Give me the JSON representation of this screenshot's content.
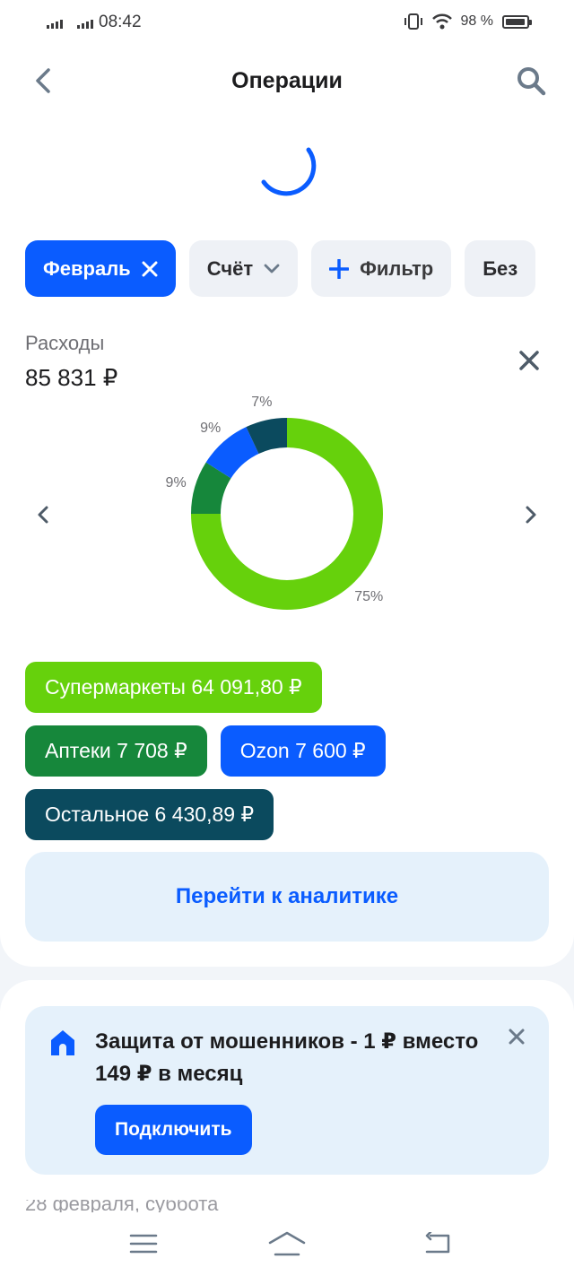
{
  "status_bar": {
    "time": "08:42",
    "battery": "98 %"
  },
  "header": {
    "title": "Операции"
  },
  "filters": [
    {
      "label": "Февраль",
      "active": true,
      "icon": "close-icon"
    },
    {
      "label": "Счёт",
      "active": false,
      "icon": "chevron-down-icon"
    },
    {
      "label": "Фильтр",
      "active": false,
      "icon": "plus-icon"
    },
    {
      "label": "Без",
      "active": false,
      "icon": ""
    }
  ],
  "expenses": {
    "label": "Расходы",
    "value": "85 831 ₽"
  },
  "chart_data": {
    "type": "pie",
    "title": "",
    "categories": [
      "Супермаркеты",
      "Аптеки",
      "Ozon",
      "Остальное"
    ],
    "values": [
      75,
      9,
      9,
      7
    ],
    "value_labels": [
      "75%",
      "9%",
      "9%",
      "7%"
    ],
    "colors": [
      "#66d10c",
      "#16873b",
      "#0a5cff",
      "#0b4a5e"
    ]
  },
  "legend": [
    {
      "label": "Супермаркеты 64 091,80 ₽",
      "color": "#66d10c"
    },
    {
      "label": "Аптеки 7 708 ₽",
      "color": "#16873b"
    },
    {
      "label": "Ozon 7 600 ₽",
      "color": "#0a5cff"
    },
    {
      "label": "Остальное 6 430,89 ₽",
      "color": "#0b4a5e"
    }
  ],
  "analytics_button": "Перейти к аналитике",
  "promo": {
    "title": "Защита от мошенников - 1 ₽ вместо 149 ₽ в месяц",
    "button": "Подключить"
  },
  "next_section_peek": "28 февраля, суббота",
  "colors": {
    "accent": "#0a5cff",
    "light_panel": "#e5f1fb",
    "chip_bg": "#eef1f6"
  }
}
